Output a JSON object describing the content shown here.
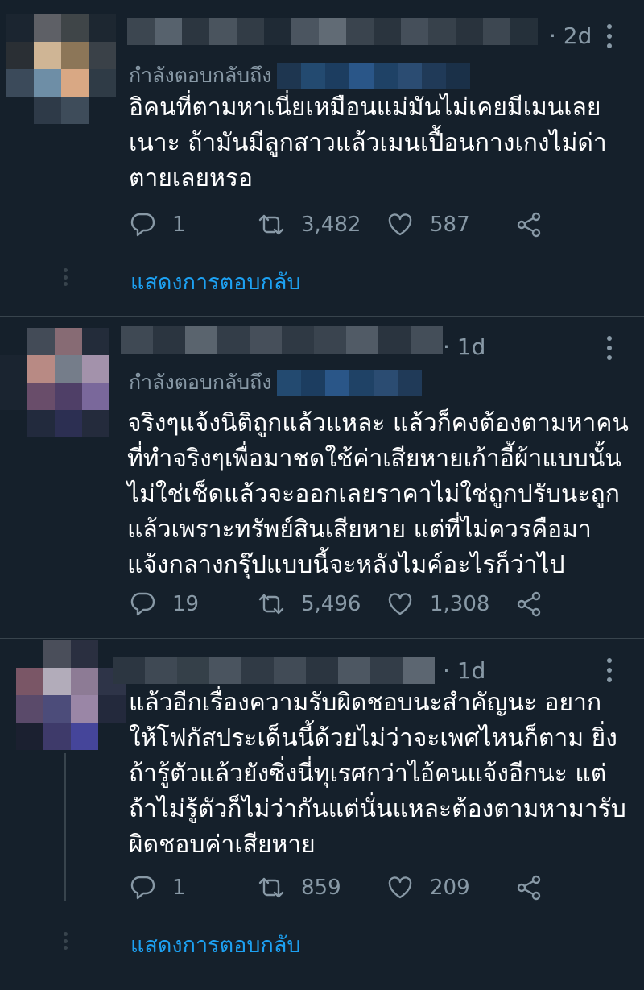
{
  "tweets": [
    {
      "time": "· 2d",
      "reply_to": "กำลังตอบกลับถึง",
      "lines": [
        "อิคนที่ตามหาเนี่ยเหมือนแม่มันไม่เคยมีเมนเลย",
        "เนาะ ถ้ามันมีลูกสาวแล้วเมนเปื้อนกางเกงไม่ด่า",
        "ตายเลยหรอ"
      ],
      "replies": "1",
      "retweets": "3,482",
      "likes": "587",
      "show_replies": "แสดงการตอบกลับ"
    },
    {
      "time": "· 1d",
      "reply_to": "กำลังตอบกลับถึง",
      "lines": [
        "จริงๆแจ้งนิติถูกแล้วแหละ แล้วก็คงต้องตามหาคน",
        "ที่ทำจริงๆเพื่อมาชดใช้ค่าเสียหายเก้าอี้ผ้าแบบนั้น",
        "ไม่ใช่เช็ดแล้วจะออกเลยราคาไม่ใช่ถูกปรับนะถูก",
        "แล้วเพราะทรัพย์สินเสียหาย แต่ที่ไม่ควรคือมา",
        "แจ้งกลางกรุ๊ปแบบนี้จะหลังไมค์อะไรก็ว่าไป"
      ],
      "replies": "19",
      "retweets": "5,496",
      "likes": "1,308"
    },
    {
      "time": "· 1d",
      "lines": [
        "แล้วอีกเรื่องความรับผิดชอบนะสำคัญนะ อยาก",
        "ให้โฟกัสประเด็นนี้ด้วยไม่ว่าจะเพศไหนก็ตาม ยิ่ง",
        "ถ้ารู้ตัวแล้วยังซิ่งนี่ทุเรศกว่าไอ้คนแจ้งอีกนะ แต่",
        "ถ้าไม่รู้ตัวก็ไม่ว่ากันแต่นั่นแหละต้องตามหามารับ",
        "ผิดชอบค่าเสียหาย"
      ],
      "replies": "1",
      "retweets": "859",
      "likes": "209",
      "show_replies": "แสดงการตอบกลับ"
    }
  ],
  "icons": {
    "reply": "reply-icon",
    "retweet": "retweet-icon",
    "like": "heart-icon",
    "share": "share-icon",
    "more": "more-icon"
  },
  "colors": {
    "background": "#15202b",
    "secondary_text": "#8899a6",
    "link": "#1da1f2",
    "divider": "#38444d"
  }
}
